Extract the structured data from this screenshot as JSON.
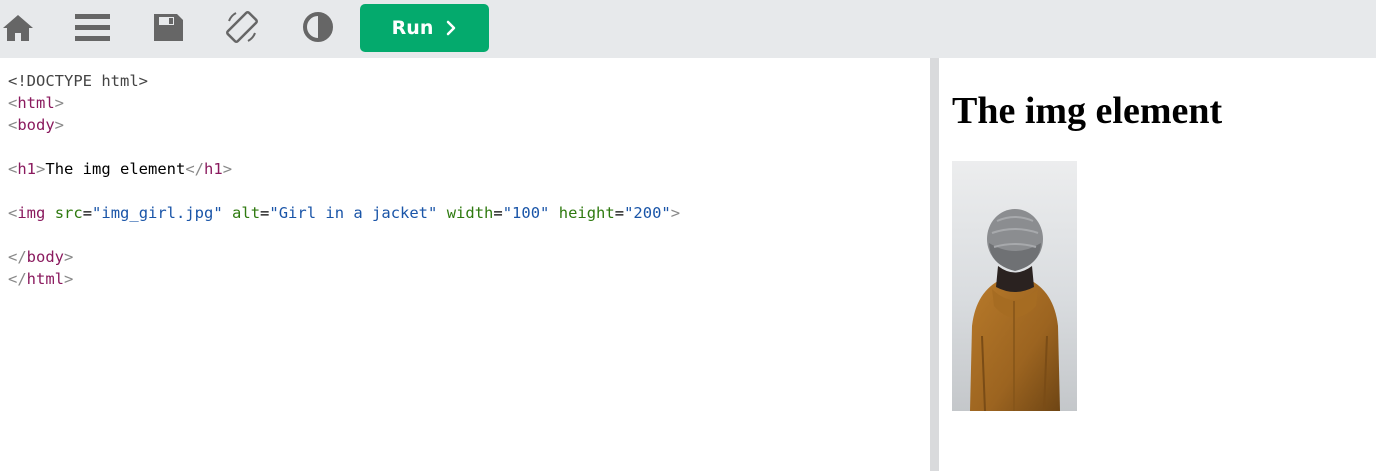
{
  "toolbar": {
    "icons": [
      "home-icon",
      "menu-icon",
      "save-icon",
      "rotate-icon",
      "contrast-icon"
    ],
    "run_label": "Run",
    "run_color": "#04aa6d",
    "background": "#e7e9eb"
  },
  "editor": {
    "lines": [
      {
        "doctype": "<!DOCTYPE html>"
      },
      {
        "open": "<",
        "tag": "html",
        "close": ">"
      },
      {
        "open": "<",
        "tag": "body",
        "close": ">"
      },
      {},
      {
        "open": "<",
        "tag": "h1",
        "close": ">",
        "text": "The img element",
        "open2": "</",
        "tag2": "h1",
        "close2": ">"
      },
      {},
      {
        "open": "<",
        "tag": "img",
        "sp1": " ",
        "a1": "src",
        "eq1": "=",
        "v1": "\"img_girl.jpg\"",
        "sp2": " ",
        "a2": "alt",
        "eq2": "=",
        "v2": "\"Girl in a jacket\"",
        "sp3": " ",
        "a3": "width",
        "eq3": "=",
        "v3": "\"100\"",
        "sp4": " ",
        "a4": "height",
        "eq4": "=",
        "v4": "\"200\"",
        "close": ">"
      },
      {},
      {
        "open": "</",
        "tag": "body",
        "close": ">"
      },
      {
        "open": "</",
        "tag": "html",
        "close": ">"
      }
    ],
    "colors": {
      "bracket": "#888888",
      "tag": "#8a1a5e",
      "attribute": "#2f7a10",
      "value": "#1a55a8"
    }
  },
  "preview": {
    "heading": "The img element",
    "image": {
      "alt": "Girl in a jacket"
    }
  }
}
